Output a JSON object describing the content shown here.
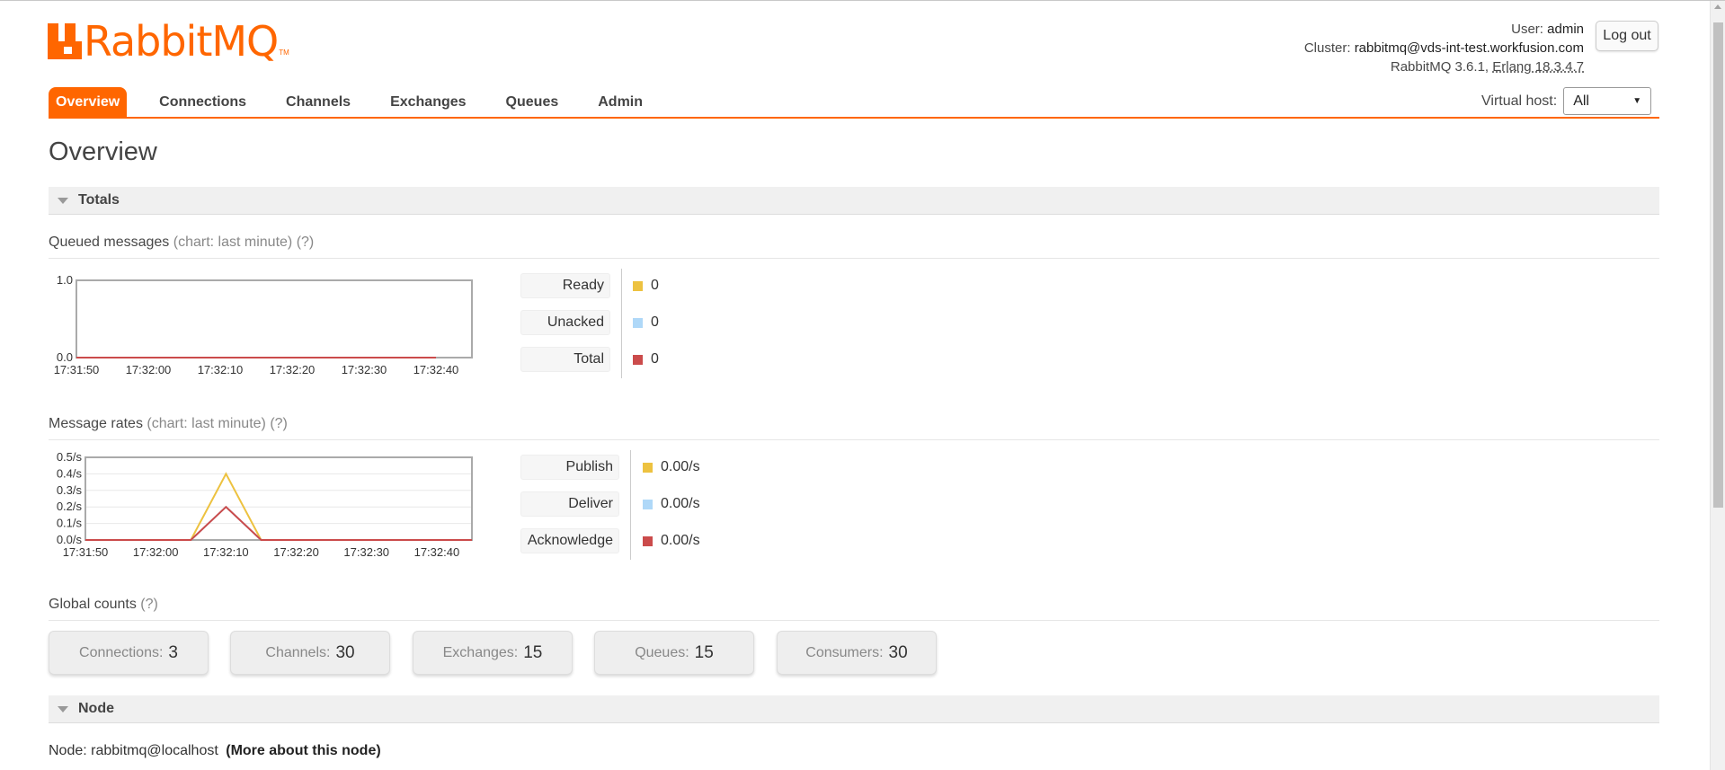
{
  "header": {
    "logo_text": "RabbitMQ",
    "logo_tm": "TM",
    "user_label": "User:",
    "user": "admin",
    "cluster_label": "Cluster:",
    "cluster": "rabbitmq@vds-int-test.workfusion.com",
    "version": "RabbitMQ 3.6.1,",
    "erlang": "Erlang 18.3.4.7",
    "logout": "Log out"
  },
  "nav": {
    "tabs": [
      "Overview",
      "Connections",
      "Channels",
      "Exchanges",
      "Queues",
      "Admin"
    ],
    "active": "Overview"
  },
  "vhost": {
    "label": "Virtual host:",
    "selected": "All"
  },
  "page_title": "Overview",
  "totals": {
    "title": "Totals",
    "queued": {
      "title": "Queued messages",
      "suffix": "(chart: last minute)",
      "help": "(?)",
      "legend": [
        {
          "label": "Ready",
          "value": "0",
          "color": "#edc240"
        },
        {
          "label": "Unacked",
          "value": "0",
          "color": "#afd8f8"
        },
        {
          "label": "Total",
          "value": "0",
          "color": "#cb4b4b"
        }
      ]
    },
    "rates": {
      "title": "Message rates",
      "suffix": "(chart: last minute)",
      "help": "(?)",
      "legend": [
        {
          "label": "Publish",
          "value": "0.00/s",
          "color": "#edc240"
        },
        {
          "label": "Deliver",
          "value": "0.00/s",
          "color": "#afd8f8"
        },
        {
          "label": "Acknowledge",
          "value": "0.00/s",
          "color": "#cb4b4b"
        }
      ]
    },
    "global": {
      "title": "Global counts",
      "help": "(?)",
      "counts": [
        {
          "label": "Connections:",
          "value": "3"
        },
        {
          "label": "Channels:",
          "value": "30"
        },
        {
          "label": "Exchanges:",
          "value": "15"
        },
        {
          "label": "Queues:",
          "value": "15"
        },
        {
          "label": "Consumers:",
          "value": "30"
        }
      ]
    }
  },
  "node": {
    "title": "Node",
    "label": "Node:",
    "name": "rabbitmq@localhost",
    "more": "(More about this node)"
  },
  "chart_data": [
    {
      "type": "line",
      "title": "Queued messages",
      "x": [
        "17:31:50",
        "17:32:00",
        "17:32:10",
        "17:32:20",
        "17:32:30",
        "17:32:40"
      ],
      "y_ticks": [
        "0.0",
        "1.0"
      ],
      "ylim": [
        0,
        1
      ],
      "series": [
        {
          "name": "Ready",
          "color": "#edc240",
          "values": [
            0,
            0,
            0,
            0,
            0,
            0
          ]
        },
        {
          "name": "Unacked",
          "color": "#afd8f8",
          "values": [
            0,
            0,
            0,
            0,
            0,
            0
          ]
        },
        {
          "name": "Total",
          "color": "#cb4b4b",
          "values": [
            0,
            0,
            0,
            0,
            0,
            0
          ]
        }
      ]
    },
    {
      "type": "line",
      "title": "Message rates",
      "x": [
        "17:31:50",
        "17:32:00",
        "17:32:10",
        "17:32:20",
        "17:32:30",
        "17:32:40"
      ],
      "y_ticks": [
        "0.0/s",
        "0.1/s",
        "0.2/s",
        "0.3/s",
        "0.4/s",
        "0.5/s"
      ],
      "ylim": [
        0,
        0.5
      ],
      "points_x_seconds": [
        0,
        5,
        10,
        15,
        20,
        25,
        30,
        35,
        40,
        45,
        50,
        55
      ],
      "series": [
        {
          "name": "Publish",
          "color": "#edc240",
          "values": [
            0,
            0,
            0,
            0,
            0.4,
            0,
            0,
            0,
            0,
            0,
            0,
            0
          ]
        },
        {
          "name": "Deliver",
          "color": "#afd8f8",
          "values": [
            0,
            0,
            0,
            0,
            0.2,
            0,
            0,
            0,
            0,
            0,
            0,
            0
          ]
        },
        {
          "name": "Acknowledge",
          "color": "#cb4b4b",
          "values": [
            0,
            0,
            0,
            0,
            0.2,
            0,
            0,
            0,
            0,
            0,
            0,
            0
          ]
        }
      ]
    }
  ]
}
